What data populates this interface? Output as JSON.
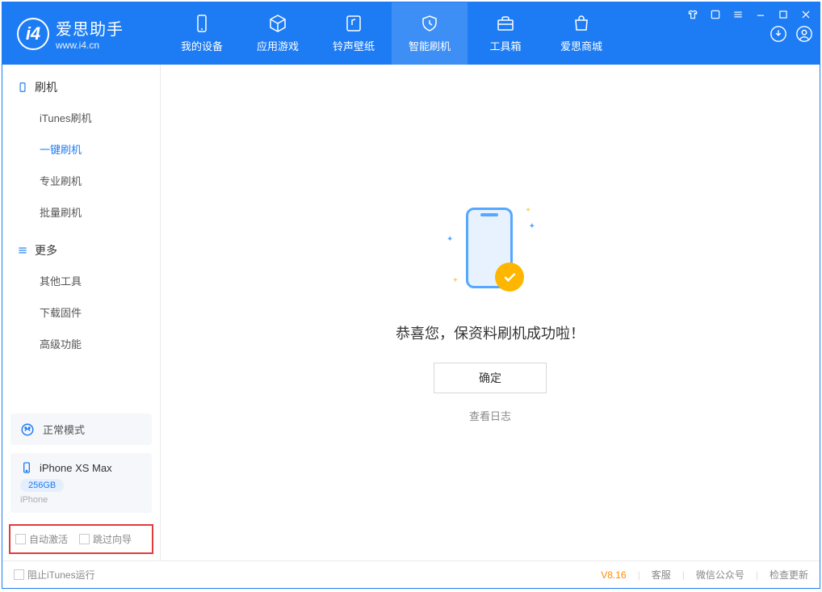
{
  "app": {
    "name_cn": "爱思助手",
    "name_en": "www.i4.cn"
  },
  "nav": [
    {
      "label": "我的设备",
      "icon": "phone"
    },
    {
      "label": "应用游戏",
      "icon": "cube"
    },
    {
      "label": "铃声壁纸",
      "icon": "music"
    },
    {
      "label": "智能刷机",
      "icon": "shield",
      "active": true
    },
    {
      "label": "工具箱",
      "icon": "toolbox"
    },
    {
      "label": "爱思商城",
      "icon": "bag"
    }
  ],
  "window_controls": [
    "shirt-icon",
    "square-icon",
    "menu-icon",
    "minimize-icon",
    "maximize-icon",
    "close-icon"
  ],
  "header_right": [
    "download-icon",
    "user-icon"
  ],
  "sidebar": {
    "section_flash": {
      "title": "刷机",
      "items": [
        "iTunes刷机",
        "一键刷机",
        "专业刷机",
        "批量刷机"
      ],
      "active_index": 1
    },
    "section_more": {
      "title": "更多",
      "items": [
        "其他工具",
        "下载固件",
        "高级功能"
      ]
    },
    "mode_box": "正常模式",
    "device": {
      "name": "iPhone XS Max",
      "storage": "256GB",
      "type": "iPhone"
    },
    "options": {
      "auto_activate": "自动激活",
      "skip_guide": "跳过向导"
    }
  },
  "main": {
    "success_msg": "恭喜您，保资料刷机成功啦！",
    "ok_label": "确定",
    "log_link": "查看日志"
  },
  "statusbar": {
    "block_itunes": "阻止iTunes运行",
    "version": "V8.16",
    "links": [
      "客服",
      "微信公众号",
      "检查更新"
    ]
  }
}
